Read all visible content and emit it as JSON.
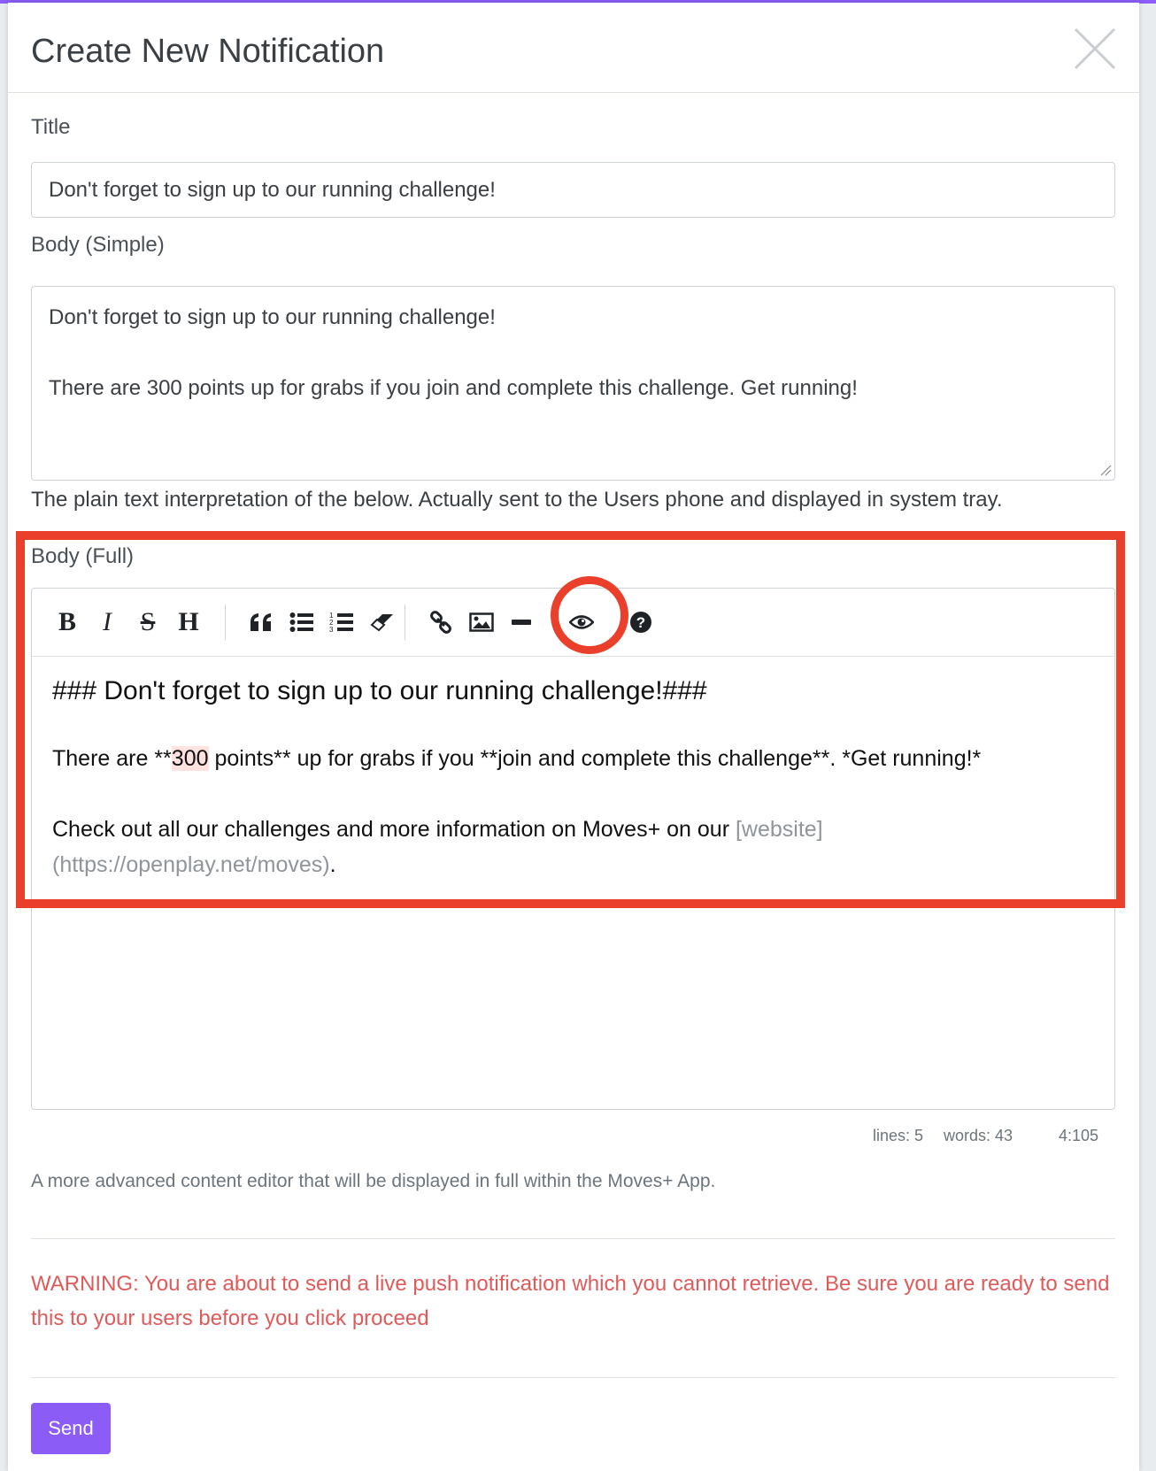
{
  "modal": {
    "title": "Create New Notification"
  },
  "form": {
    "title_label": "Title",
    "title_value": "Don't forget to sign up to our running challenge!",
    "body_simple_label": "Body (Simple)",
    "body_simple_value": "Don't forget to sign up to our running challenge!\n\nThere are 300 points up for grabs if you join and complete this challenge. Get running!",
    "body_simple_help": "The plain text interpretation of the below. Actually sent to the Users phone and displayed in system tray.",
    "body_full_label": "Body (Full)",
    "body_full_help": "A more advanced content editor that will be displayed in full within the Moves+ App."
  },
  "editor": {
    "toolbar": [
      "bold",
      "italic",
      "strikethrough",
      "heading",
      "quote",
      "unordered-list",
      "ordered-list",
      "clean-block",
      "link",
      "image",
      "horizontal-rule",
      "preview",
      "guide"
    ],
    "line1": "### Don't forget to sign up to our running challenge!###",
    "line2_pre": "There are **",
    "line2_num": "300",
    "line2_post": " points** up for grabs if you **join and complete this challenge**. *Get running!*",
    "line3_pre": "Check out all our challenges and more information on Moves+ on our ",
    "line3_link_text": "[website]",
    "line3_link_url": "(https://openplay.net/moves)",
    "line3_end": ".",
    "status": {
      "lines": "lines: 5",
      "words": "words: 43",
      "cursor": "4:105"
    }
  },
  "warning": "WARNING: You are about to send a live push notification which you cannot retrieve. Be sure you are ready to send this to your users before you click proceed",
  "send_label": "Send",
  "colors": {
    "accent": "#8b5cf6",
    "annotation": "#ea3f2a",
    "warning": "#e05a5a"
  }
}
